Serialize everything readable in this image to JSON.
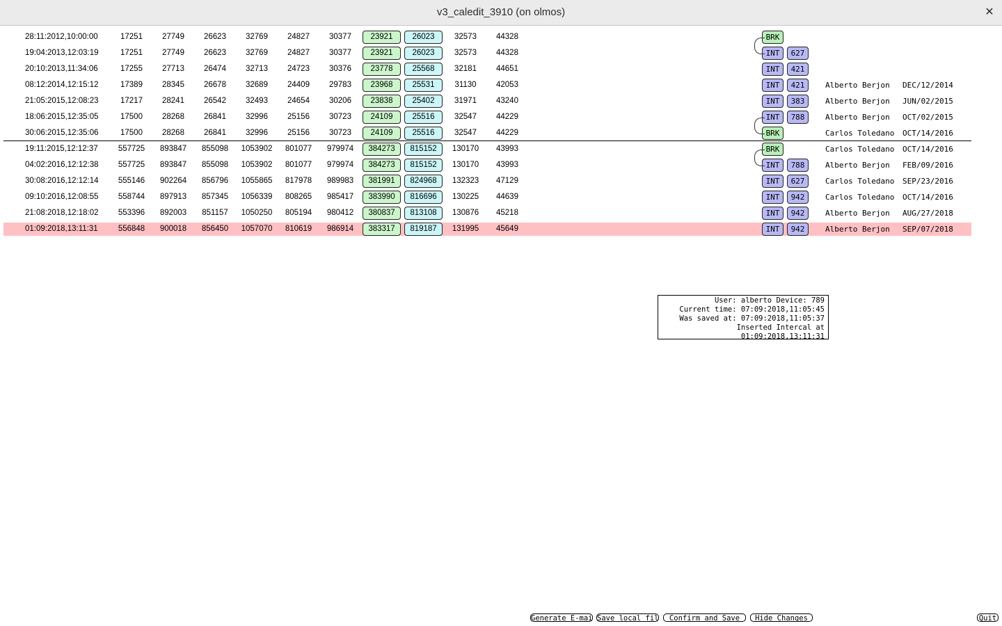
{
  "window": {
    "title": "v3_caledit_3910 (on olmos)",
    "close_icon": "✕"
  },
  "rows": [
    {
      "time": "28:11:2012,10:00:00",
      "n1": "17251",
      "n2": "27749",
      "n3": "26623",
      "n4": "32769",
      "n5": "24827",
      "n6": "30377",
      "g": "23921",
      "c": "26023",
      "n7": "32573",
      "n8": "44328",
      "type": "BRK",
      "device": "",
      "user": "",
      "date": ""
    },
    {
      "time": "19:04:2013,12:03:19",
      "n1": "17251",
      "n2": "27749",
      "n3": "26623",
      "n4": "32769",
      "n5": "24827",
      "n6": "30377",
      "g": "23921",
      "c": "26023",
      "n7": "32573",
      "n8": "44328",
      "type": "INT",
      "device": "627",
      "user": "",
      "date": ""
    },
    {
      "time": "20:10:2013,11:34:06",
      "n1": "17255",
      "n2": "27713",
      "n3": "26474",
      "n4": "32713",
      "n5": "24723",
      "n6": "30376",
      "g": "23778",
      "c": "25568",
      "n7": "32181",
      "n8": "44651",
      "type": "INT",
      "device": "421",
      "user": "",
      "date": ""
    },
    {
      "time": "08:12:2014,12:15:12",
      "n1": "17389",
      "n2": "28345",
      "n3": "26678",
      "n4": "32689",
      "n5": "24409",
      "n6": "29783",
      "g": "23968",
      "c": "25531",
      "n7": "31130",
      "n8": "42053",
      "type": "INT",
      "device": "421",
      "user": "Alberto Berjon",
      "date": "DEC/12/2014"
    },
    {
      "time": "21:05:2015,12:08:23",
      "n1": "17217",
      "n2": "28241",
      "n3": "26542",
      "n4": "32493",
      "n5": "24654",
      "n6": "30206",
      "g": "23838",
      "c": "25402",
      "n7": "31971",
      "n8": "43240",
      "type": "INT",
      "device": "383",
      "user": "Alberto Berjon",
      "date": "JUN/02/2015"
    },
    {
      "time": "18:06:2015,12:35:05",
      "n1": "17500",
      "n2": "28268",
      "n3": "26841",
      "n4": "32996",
      "n5": "25156",
      "n6": "30723",
      "g": "24109",
      "c": "25516",
      "n7": "32547",
      "n8": "44229",
      "type": "INT",
      "device": "788",
      "user": "Alberto Berjon",
      "date": "OCT/02/2015"
    },
    {
      "time": "30:06:2015,12:35:06",
      "n1": "17500",
      "n2": "28268",
      "n3": "26841",
      "n4": "32996",
      "n5": "25156",
      "n6": "30723",
      "g": "24109",
      "c": "25516",
      "n7": "32547",
      "n8": "44229",
      "type": "BRK",
      "device": "",
      "user": "Carlos Toledano",
      "date": "OCT/14/2016"
    },
    {
      "time": "19:11:2015,12:12:37",
      "n1": "557725",
      "n2": "893847",
      "n3": "855098",
      "n4": "1053902",
      "n5": "801077",
      "n6": "979974",
      "g": "384273",
      "c": "815152",
      "n7": "130170",
      "n8": "43993",
      "type": "BRK",
      "device": "",
      "user": "Carlos Toledano",
      "date": "OCT/14/2016"
    },
    {
      "time": "04:02:2016,12:12:38",
      "n1": "557725",
      "n2": "893847",
      "n3": "855098",
      "n4": "1053902",
      "n5": "801077",
      "n6": "979974",
      "g": "384273",
      "c": "815152",
      "n7": "130170",
      "n8": "43993",
      "type": "INT",
      "device": "788",
      "user": "Alberto Berjon",
      "date": "FEB/09/2016"
    },
    {
      "time": "30:08:2016,12:12:14",
      "n1": "555146",
      "n2": "902264",
      "n3": "856796",
      "n4": "1055865",
      "n5": "817978",
      "n6": "989983",
      "g": "381991",
      "c": "824968",
      "n7": "132323",
      "n8": "47129",
      "type": "INT",
      "device": "627",
      "user": "Carlos Toledano",
      "date": "SEP/23/2016"
    },
    {
      "time": "09:10:2016,12:08:55",
      "n1": "558744",
      "n2": "897913",
      "n3": "857345",
      "n4": "1056339",
      "n5": "808265",
      "n6": "985417",
      "g": "383990",
      "c": "816696",
      "n7": "130225",
      "n8": "44639",
      "type": "INT",
      "device": "942",
      "user": "Carlos Toledano",
      "date": "OCT/14/2016"
    },
    {
      "time": "21:08:2018,12:18:02",
      "n1": "553396",
      "n2": "892003",
      "n3": "851157",
      "n4": "1050250",
      "n5": "805194",
      "n6": "980412",
      "g": "380837",
      "c": "813108",
      "n7": "130876",
      "n8": "45218",
      "type": "INT",
      "device": "942",
      "user": "Alberto Berjon",
      "date": "AUG/27/2018"
    },
    {
      "time": "01:09:2018,13:11:31",
      "n1": "556848",
      "n2": "900018",
      "n3": "856450",
      "n4": "1057070",
      "n5": "810619",
      "n6": "986914",
      "g": "383317",
      "c": "819187",
      "n7": "131995",
      "n8": "45649",
      "type": "INT",
      "device": "942",
      "user": "Alberto Berjon",
      "date": "SEP/07/2018"
    }
  ],
  "info": {
    "line1": "User: alberto Device: 789",
    "line2": "Current time: 07:09:2018,11:05:45",
    "line3": "Was saved at: 07:09:2018,11:05:37",
    "line4": "Inserted Intercal at 01:09:2018,13:11:31"
  },
  "buttons": {
    "generate_email": "Generate E-mail",
    "save_local": "Save local file",
    "confirm_save": "Confirm and Save",
    "hide_changes": "Hide Changes",
    "quit": "Quit"
  },
  "colors": {
    "green_box": "#ccf5cc",
    "cyan_box": "#ccf5f8",
    "int_tag": "#b8b8f5",
    "brk_tag": "#b8f0b8",
    "highlight_row": "#ffc0c3"
  }
}
